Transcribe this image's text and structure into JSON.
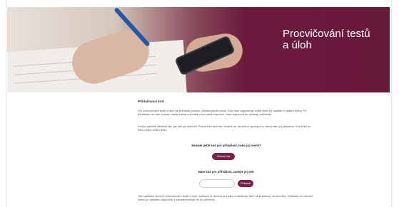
{
  "hero": {
    "title": "Procvičování testů\na úloh"
  },
  "intro": {
    "heading": "Přihlašovací kód",
    "paragraph1": "Pro procvičování testů a úloh se přihlaste pomocí přihlašovacího kódu. Kód vám vygeneruje učitel nebo jej najdete v zadání úlohy. Po přihlášení se vám zobrazí zadání testu a budete moci začít pracovat. Vaše odpovědi se ukládají průběžně.",
    "paragraph2": "Kód je potřeba zadávat tak, jak jste jej obdrželi. Pokud kód nemáte, obraťte se na svého vyučujícího, který vám jej poskytne. Kód platí po celou dobu trvání testu."
  },
  "have_code": {
    "prompt": "Nemáte ještě kód pro přihlášení, nebo jej nevíte?",
    "button": "Získat kód"
  },
  "enter_code": {
    "prompt": "Máte kód pro přihlášení, zadejte jej zde:",
    "input_value": "",
    "input_placeholder": "",
    "button": "Přihlásit"
  },
  "footer": {
    "paragraph": "Tato aplikace slouží k procvičování testů a úloh. Aplikace je určena pro žáky a studenty, kteří se připravují na zkoušky. Výsledky se zobrazí ihned po odeslání odpovědí a zaznamenávají se do přehledu."
  }
}
